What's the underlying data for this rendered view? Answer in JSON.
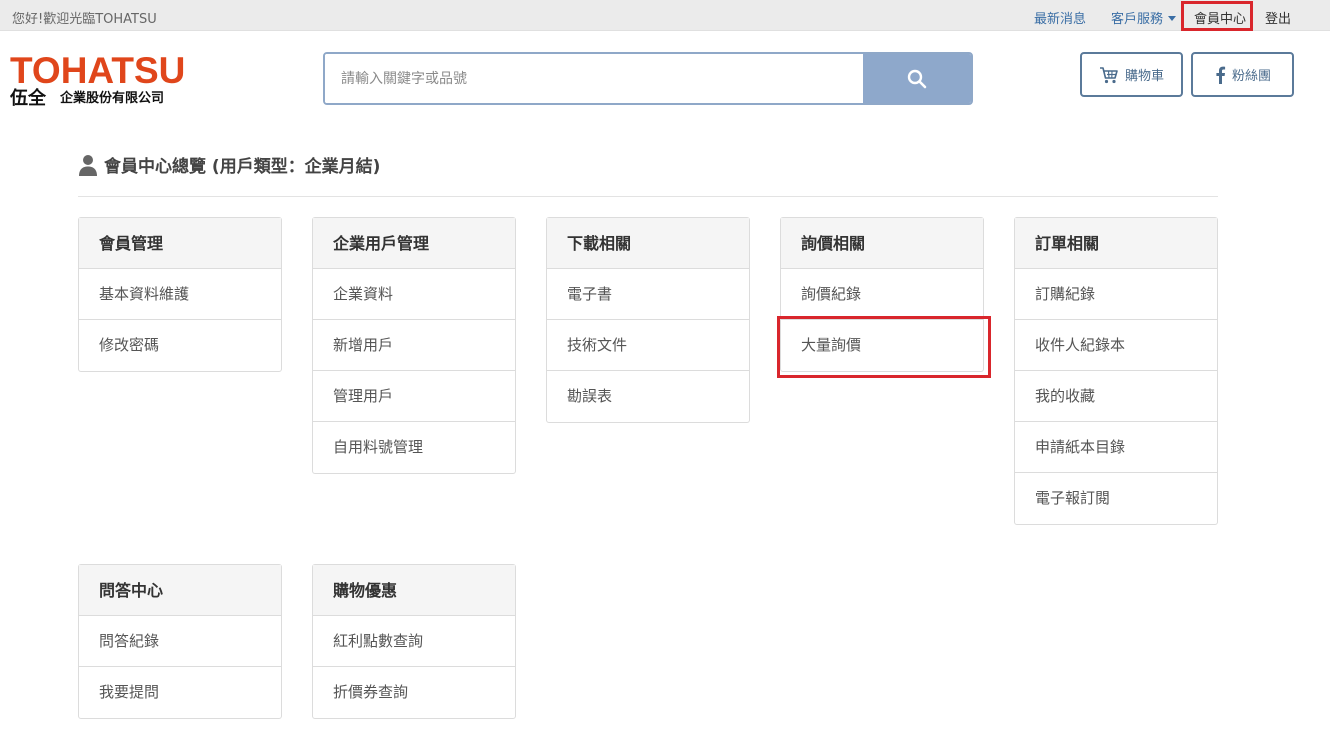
{
  "topbar": {
    "greeting": "您好!歡迎光臨TOHATSU",
    "nav": {
      "news": "最新消息",
      "service": "客戶服務",
      "member": "會員中心",
      "logout": "登出"
    }
  },
  "logo": {
    "brand": "TOHATSU",
    "chinese_large": "伍全",
    "chinese_small": "企業股份有限公司"
  },
  "search": {
    "placeholder": "請輸入關鍵字或品號",
    "value": ""
  },
  "header_buttons": {
    "cart": "購物車",
    "fans": "粉絲團"
  },
  "page": {
    "title": "會員中心總覽 (用戶類型：企業月結)"
  },
  "panels": [
    {
      "title": "會員管理",
      "items": [
        "基本資料維護",
        "修改密碼"
      ]
    },
    {
      "title": "企業用戶管理",
      "items": [
        "企業資料",
        "新增用戶",
        "管理用戶",
        "自用料號管理"
      ]
    },
    {
      "title": "下載相關",
      "items": [
        "電子書",
        "技術文件",
        "勘誤表"
      ]
    },
    {
      "title": "詢價相關",
      "items": [
        "詢價紀錄",
        "大量詢價"
      ]
    },
    {
      "title": "訂單相關",
      "items": [
        "訂購紀錄",
        "收件人紀錄本",
        "我的收藏",
        "申請紙本目錄",
        "電子報訂閱"
      ]
    },
    {
      "title": "問答中心",
      "items": [
        "問答紀錄",
        "我要提問"
      ]
    },
    {
      "title": "購物優惠",
      "items": [
        "紅利點數查詢",
        "折價券查詢"
      ]
    }
  ],
  "colors": {
    "brand_orange": "#e0461b",
    "link_blue": "#3a6ea5",
    "search_button": "#8ea8cb",
    "highlight_red": "#d9262c"
  }
}
